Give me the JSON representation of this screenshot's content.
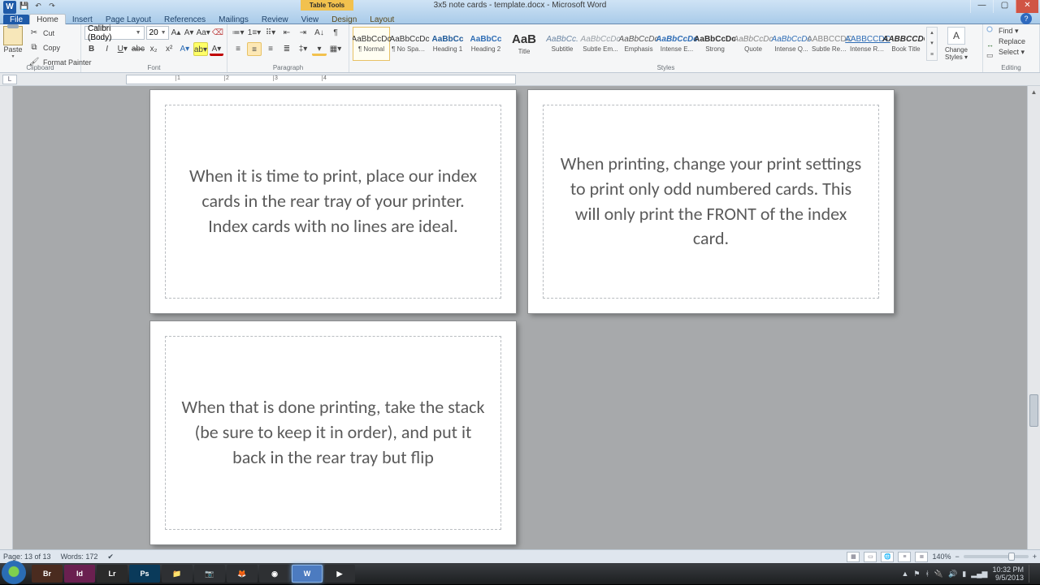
{
  "title": "3x5 note cards - template.docx - Microsoft Word",
  "tool_tab": "Table Tools",
  "tabs": [
    "File",
    "Home",
    "Insert",
    "Page Layout",
    "References",
    "Mailings",
    "Review",
    "View",
    "Design",
    "Layout"
  ],
  "active_tab": "Home",
  "clipboard": {
    "paste": "Paste",
    "cut": "Cut",
    "copy": "Copy",
    "painter": "Format Painter",
    "group": "Clipboard"
  },
  "font": {
    "name": "Calibri (Body)",
    "size": "20",
    "group": "Font"
  },
  "paragraph": {
    "group": "Paragraph"
  },
  "styles": {
    "group": "Styles",
    "change": "Change Styles ▾",
    "items": [
      {
        "sample": "AaBbCcDc",
        "name": "¶ Normal",
        "sel": true,
        "color": "#333"
      },
      {
        "sample": "AaBbCcDc",
        "name": "¶ No Spaci...",
        "color": "#333"
      },
      {
        "sample": "AaBbCc",
        "name": "Heading 1",
        "bold": true,
        "color": "#1f5a99"
      },
      {
        "sample": "AaBbCc",
        "name": "Heading 2",
        "bold": true,
        "color": "#2f6db5"
      },
      {
        "sample": "AaB",
        "name": "Title",
        "bold": true,
        "color": "#333",
        "big": true
      },
      {
        "sample": "AaBbCc.",
        "name": "Subtitle",
        "color": "#6a85a3",
        "italic": true
      },
      {
        "sample": "AaBbCcDc",
        "name": "Subtle Em...",
        "color": "#9aa0a6",
        "italic": true
      },
      {
        "sample": "AaBbCcDc",
        "name": "Emphasis",
        "color": "#555",
        "italic": true
      },
      {
        "sample": "AaBbCcDc",
        "name": "Intense E...",
        "color": "#2f6db5",
        "italic": true,
        "bold": true
      },
      {
        "sample": "AaBbCcDc",
        "name": "Strong",
        "color": "#333",
        "bold": true
      },
      {
        "sample": "AaBbCcDc",
        "name": "Quote",
        "color": "#888",
        "italic": true
      },
      {
        "sample": "AaBbCcDc",
        "name": "Intense Q...",
        "color": "#2f6db5",
        "italic": true
      },
      {
        "sample": "AABBCCDC",
        "name": "Subtle Ref...",
        "color": "#888"
      },
      {
        "sample": "AABBCCDC",
        "name": "Intense Re...",
        "color": "#2f6db5",
        "under": true
      },
      {
        "sample": "AABBCCDC",
        "name": "Book Title",
        "bold": true,
        "italic": true,
        "color": "#333"
      }
    ]
  },
  "editing": {
    "find": "Find ▾",
    "replace": "Replace",
    "select": "Select ▾",
    "group": "Editing"
  },
  "ruler_marks": [
    "",
    "1",
    "2",
    "3",
    "4"
  ],
  "cards": [
    "When it is time to print, place our index cards in the rear tray of your printer.  Index cards with no lines are ideal.",
    "When printing, change your print settings to print only odd numbered cards.  This will only print the FRONT of the index card.",
    "When that is done printing, take the stack (be sure to keep it in order), and put it back in the rear tray but flip"
  ],
  "status": {
    "page": "Page: 13 of 13",
    "words": "Words: 172",
    "zoom": "140%"
  },
  "taskbar": {
    "apps": [
      {
        "label": "Br",
        "bg": "#4a2b1f"
      },
      {
        "label": "Id",
        "bg": "#6a2050"
      },
      {
        "label": "Lr",
        "bg": "#2a2a2a"
      },
      {
        "label": "Ps",
        "bg": "#0a3a5a"
      },
      {
        "label": "📁",
        "bg": "#2e3033"
      },
      {
        "label": "📷",
        "bg": "#2e3033"
      },
      {
        "label": "🦊",
        "bg": "#2e3033"
      },
      {
        "label": "◉",
        "bg": "#2e3033"
      },
      {
        "label": "W",
        "bg": "#345f9e",
        "active": true
      },
      {
        "label": "▶",
        "bg": "#2e3033"
      }
    ],
    "time": "10:32 PM",
    "date": "9/5/2013"
  }
}
